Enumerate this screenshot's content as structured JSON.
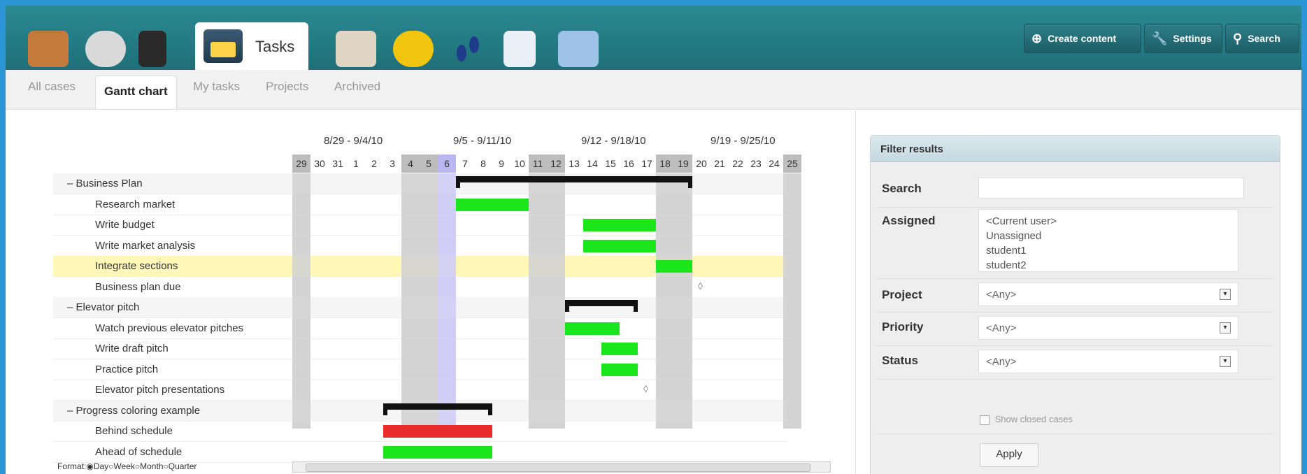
{
  "top": {
    "tasks_tab": "Tasks",
    "create_content": "Create content",
    "settings": "Settings",
    "search": "Search"
  },
  "subtabs": [
    "All cases",
    "Gantt chart",
    "My tasks",
    "Projects",
    "Archived"
  ],
  "gantt": {
    "weeks": [
      "8/29 - 9/4/10",
      "9/5 - 9/11/10",
      "9/12 - 9/18/10",
      "9/19 - 9/25/10"
    ],
    "days": [
      "29",
      "30",
      "31",
      "1",
      "2",
      "3",
      "4",
      "5",
      "6",
      "7",
      "8",
      "9",
      "10",
      "11",
      "12",
      "13",
      "14",
      "15",
      "16",
      "17",
      "18",
      "19",
      "20",
      "21",
      "22",
      "23",
      "24",
      "25"
    ],
    "weekend_days": [
      "29",
      "4",
      "5",
      "11",
      "12",
      "18",
      "19",
      "25"
    ],
    "today_day": "6",
    "rows": [
      {
        "type": "group",
        "label": "– Business Plan"
      },
      {
        "type": "task",
        "label": "Research market"
      },
      {
        "type": "task",
        "label": "Write budget"
      },
      {
        "type": "task",
        "label": "Write market analysis"
      },
      {
        "type": "task",
        "label": "Integrate sections",
        "highlight": true
      },
      {
        "type": "task",
        "label": "Business plan due"
      },
      {
        "type": "group",
        "label": "– Elevator pitch"
      },
      {
        "type": "task",
        "label": "Watch previous elevator pitches"
      },
      {
        "type": "task",
        "label": "Write draft pitch"
      },
      {
        "type": "task",
        "label": "Practice pitch"
      },
      {
        "type": "task",
        "label": "Elevator pitch presentations"
      },
      {
        "type": "group",
        "label": "– Progress coloring example"
      },
      {
        "type": "task",
        "label": "Behind schedule"
      },
      {
        "type": "task",
        "label": "Ahead of schedule"
      }
    ],
    "format_label": "Format:",
    "format_options": [
      "Day",
      "Week",
      "Month",
      "Quarter"
    ],
    "format_selected": "Day"
  },
  "filter": {
    "title": "Filter results",
    "search_label": "Search",
    "assigned_label": "Assigned",
    "assigned_options": [
      "<Current user>",
      "Unassigned",
      "student1",
      "student2"
    ],
    "project_label": "Project",
    "project_value": "<Any>",
    "priority_label": "Priority",
    "priority_value": "<Any>",
    "status_label": "Status",
    "status_value": "<Any>",
    "show_closed": "Show closed cases",
    "apply": "Apply"
  }
}
